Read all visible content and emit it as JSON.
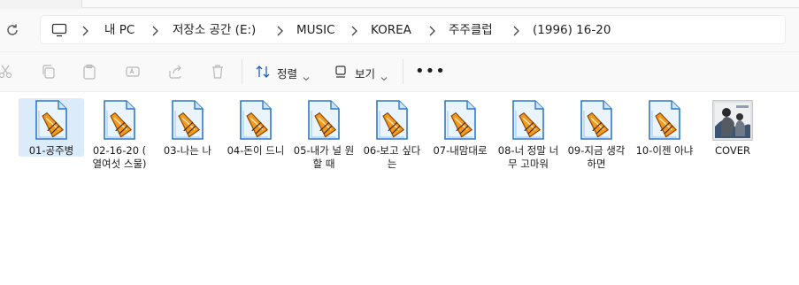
{
  "breadcrumb": [
    "내 PC",
    "저장소 공간 (E:)",
    "MUSIC",
    "KOREA",
    "주주클럽",
    "(1996) 16-20"
  ],
  "toolbar": {
    "sort_label": "정렬",
    "view_label": "보기",
    "more_label": "•••"
  },
  "files": [
    {
      "name": "01-공주병",
      "selected": true
    },
    {
      "name": "02-16-20 ( 열여섯 스물)"
    },
    {
      "name": "03-나는 나"
    },
    {
      "name": "04-돈이 드니"
    },
    {
      "name": "05-내가 널 원할 때"
    },
    {
      "name": "06-보고 싶다는"
    },
    {
      "name": "07-내맘대로"
    },
    {
      "name": "08-너 정말 너무 고마워"
    },
    {
      "name": "09-지금 생각하면"
    },
    {
      "name": "10-이젠 아냐"
    },
    {
      "name": "COVER"
    }
  ],
  "colors": {
    "selection": "#dcebfa",
    "file_icon_blue": "#2f79c9",
    "amp_orange": "#f29a1f"
  },
  "icons": {
    "refresh": "refresh-icon",
    "pc": "computer-icon",
    "cut": "cut-icon",
    "copy": "copy-icon",
    "paste": "paste-icon",
    "rename": "rename-icon",
    "share": "share-icon",
    "delete": "delete-icon",
    "sort": "sort-icon",
    "view": "view-icon",
    "audio_file": "audio-file-icon",
    "cover_image": "image-thumbnail-icon"
  }
}
